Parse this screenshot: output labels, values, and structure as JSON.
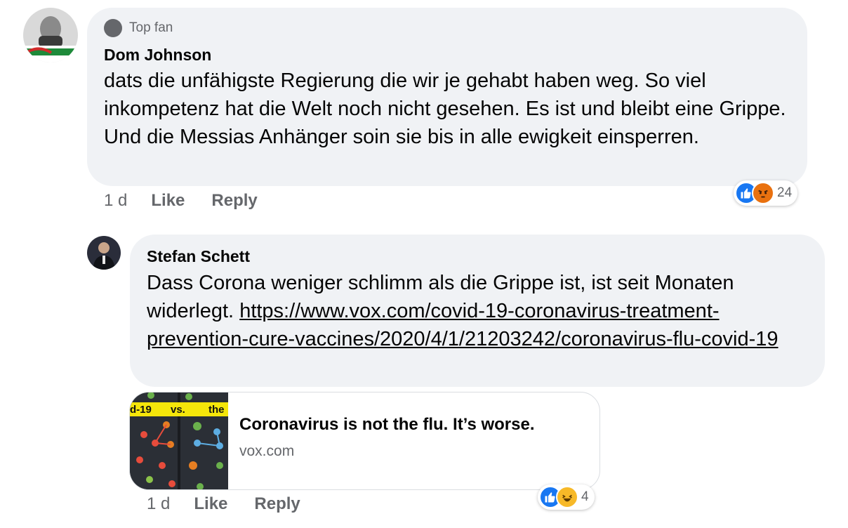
{
  "comments": [
    {
      "badge": "Top fan",
      "author": "Dom Johnson",
      "text": "dats die unfähigste Regierung die wir je gehabt haben weg. So viel inkompetenz hat die Welt noch nicht gesehen. Es ist und bleibt eine Grippe. Und die Messias Anhänger soin sie bis in alle ewigkeit einsperren.",
      "timestamp": "1 d",
      "like_label": "Like",
      "reply_label": "Reply",
      "reactions": [
        "like-icon",
        "angry-icon"
      ],
      "reaction_count": "24"
    },
    {
      "author": "Stefan Schett",
      "text": "Dass Corona weniger schlimm als die Grippe ist, ist seit Monaten widerlegt.",
      "link_url": "https://www.vox.com/covid-19-coronavirus-treatment-prevention-cure-vaccines/2020/4/1/21203242/coronavirus-flu-covid-19",
      "link_preview": {
        "thumb_text_left": "d-19",
        "thumb_text_mid": "vs.",
        "thumb_text_right": "the",
        "title": "Coronavirus is not the flu. It’s worse.",
        "domain": "vox.com"
      },
      "timestamp": "1 d",
      "like_label": "Like",
      "reply_label": "Reply",
      "reactions": [
        "like-icon",
        "haha-icon"
      ],
      "reaction_count": "4"
    }
  ],
  "colors": {
    "bubble": "#f0f2f5",
    "secondary_text": "#65676b",
    "like_blue": "#1877f2",
    "angry_orange": "#e9710f",
    "haha_yellow": "#f7b928",
    "vox_yellow": "#f5e60a"
  }
}
